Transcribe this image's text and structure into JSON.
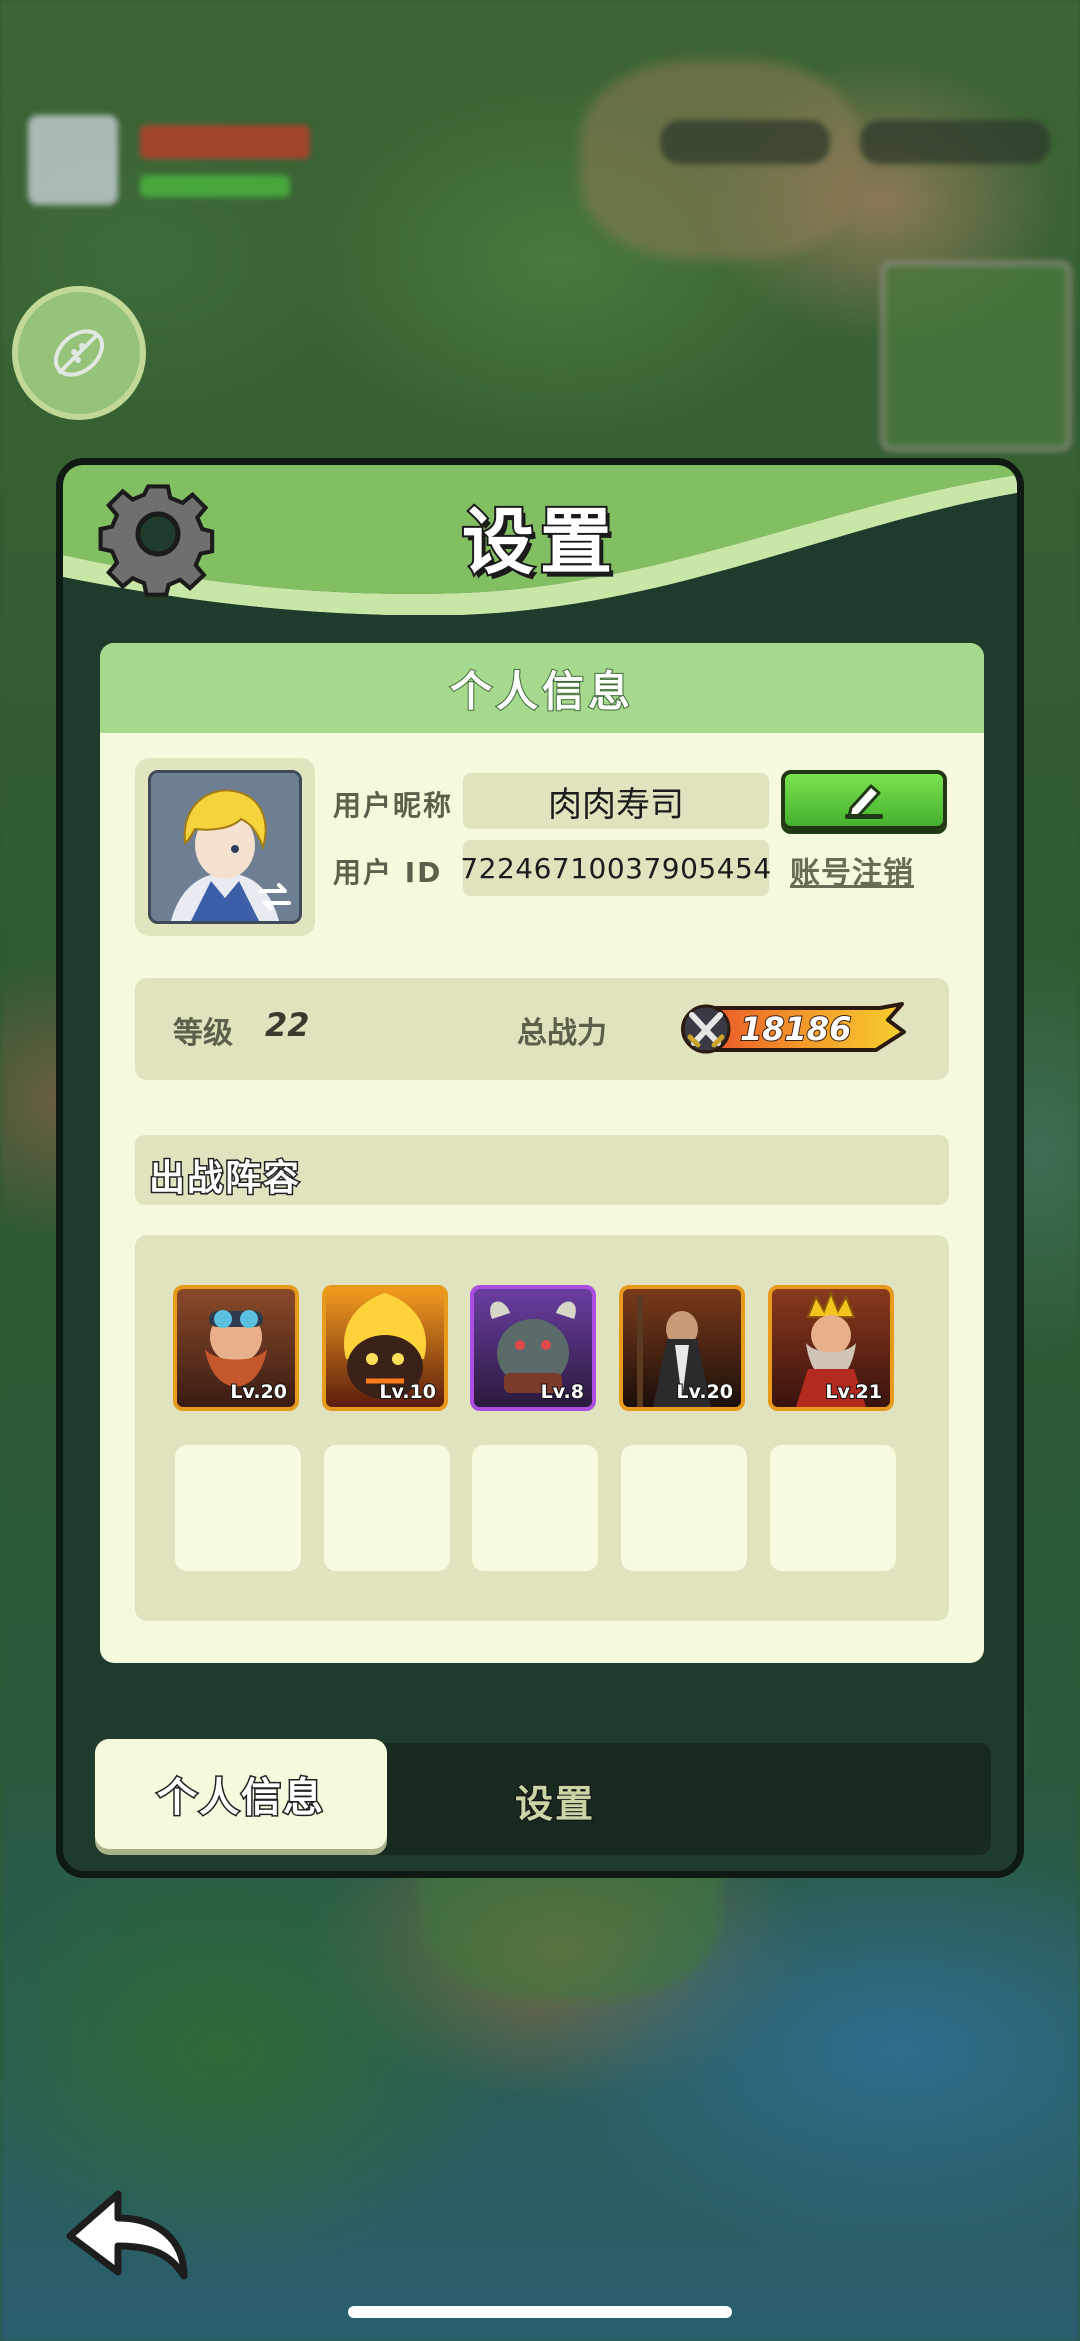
{
  "panel": {
    "title": "设置"
  },
  "profile": {
    "section_title": "个人信息",
    "nickname_label": "用户昵称",
    "nickname": "肉肉寿司",
    "id_label": "用户 ID",
    "user_id": "72246710037905454",
    "logout_label": "账号注销",
    "level_label": "等级",
    "level": "22",
    "power_label": "总战力",
    "power": "18186"
  },
  "lineup": {
    "title": "出战阵容",
    "heroes": [
      {
        "level": "Lv.20",
        "frame_color": "#e89a1c"
      },
      {
        "level": "Lv.10",
        "frame_color": "#e89a1c"
      },
      {
        "level": "Lv.8",
        "frame_color": "#a94ee0"
      },
      {
        "level": "Lv.20",
        "frame_color": "#e89a1c"
      },
      {
        "level": "Lv.21",
        "frame_color": "#e89a1c"
      }
    ],
    "empty_slots": 5
  },
  "tabs": {
    "active": "个人信息",
    "inactive": "设置"
  },
  "icons": {
    "header": "gear-icon",
    "edit": "pencil-icon",
    "power": "crossed-swords-icon",
    "back": "back-arrow-icon",
    "side": "leaf-icon"
  },
  "colors": {
    "header_green": "#a6d88d",
    "card_bg": "#f6fadc",
    "edit_button": "#5cc93a"
  }
}
